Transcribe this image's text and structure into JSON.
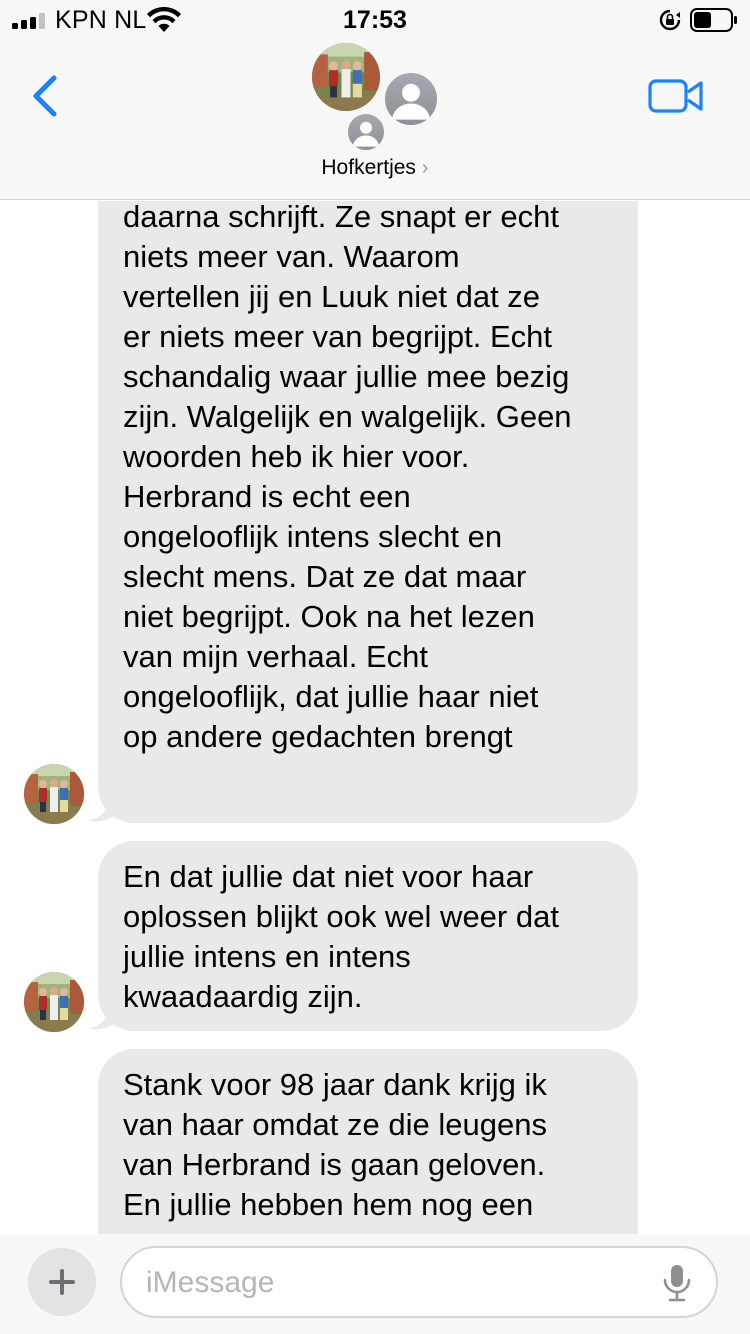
{
  "status_bar": {
    "carrier": "KPN NL",
    "time": "17:53",
    "signal_bars": 2,
    "battery_level": 0.45
  },
  "header": {
    "back_icon": "chevron-left-icon",
    "group_name": "Hofkertjes",
    "video_icon": "video-camera-icon",
    "accent_color": "#1a82fb"
  },
  "messages": [
    {
      "sender": "group-member",
      "text": "is ongelooflijk wat ze me\ndaarna schrijft. Ze snapt er echt\nniets meer van. Waarom\nvertellen jij en Luuk niet dat ze\ner niets meer van begrijpt. Echt\nschandalig waar jullie mee bezig\nzijn. Walgelijk en walgelijk. Geen\nwoorden heb ik hier voor.\nHerbrand is echt een\nongelooflijk intens slecht en\nslecht mens. Dat ze dat maar\nniet begrijpt. Ook na het lezen\nvan mijn verhaal. Echt\nongelooflijk, dat jullie haar niet\nop andere gedachten brengt"
    },
    {
      "sender": "group-member",
      "text": "En dat jullie dat niet voor haar\noplossen blijkt ook wel weer dat\njullie intens en intens\nkwaadaardig zijn."
    },
    {
      "sender": "group-member",
      "text": "Stank voor 98 jaar dank krijg ik\nvan haar omdat ze die leugens\nvan Herbrand is gaan geloven.\nEn jullie hebben hem nog een"
    }
  ],
  "composer": {
    "placeholder": "iMessage",
    "plus_icon": "plus-icon",
    "mic_icon": "microphone-icon"
  },
  "colors": {
    "bubble_received": "#e9e9eb",
    "bar_background": "#f7f7f7"
  }
}
